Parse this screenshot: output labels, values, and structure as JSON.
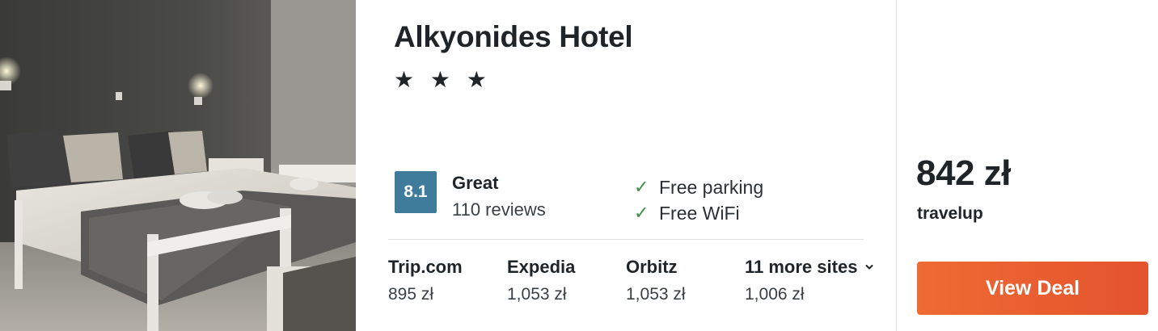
{
  "hotel": {
    "name": "Alkyonides Hotel",
    "stars": "★ ★ ★",
    "star_count": 3
  },
  "rating": {
    "score": "8.1",
    "label": "Great",
    "reviews": "110 reviews",
    "badge_color": "#3f7b9a"
  },
  "amenities": [
    {
      "icon": "check-icon",
      "glyph": "✓",
      "label": "Free parking"
    },
    {
      "icon": "check-icon",
      "glyph": "✓",
      "label": "Free WiFi"
    }
  ],
  "sites": [
    {
      "name": "Trip.com",
      "price": "895 zł"
    },
    {
      "name": "Expedia",
      "price": "1,053 zł"
    },
    {
      "name": "Orbitz",
      "price": "1,053 zł"
    },
    {
      "name": "11 more sites",
      "price": "1,006 zł",
      "icon": "chevron-down-icon"
    }
  ],
  "deal": {
    "price": "842 zł",
    "provider": "travelup",
    "button_label": "View Deal",
    "button_color": "#e85c30"
  },
  "photo": {
    "icon": "hotel-room-photo"
  }
}
